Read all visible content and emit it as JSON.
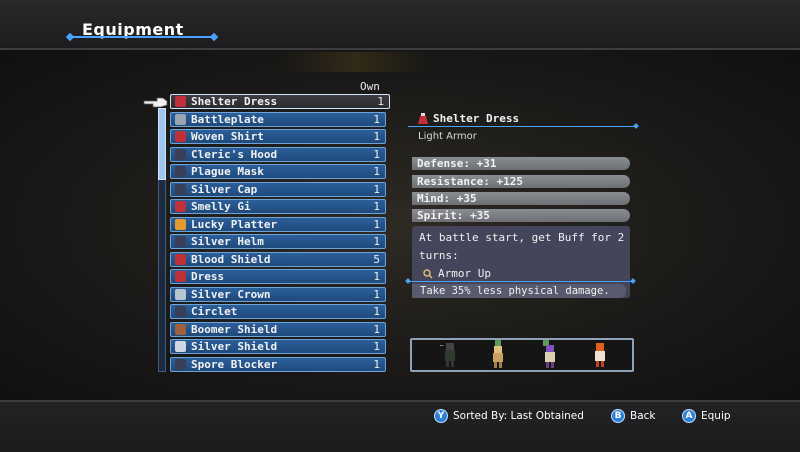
{
  "header": {
    "title": "Equipment"
  },
  "list": {
    "own_header": "Own",
    "items": [
      {
        "name": "Shelter Dress",
        "count": "1",
        "icon": "dress-icon",
        "color": "#c0303a"
      },
      {
        "name": "Battleplate",
        "count": "1",
        "icon": "armor-icon",
        "color": "#9aa4b0"
      },
      {
        "name": "Woven Shirt",
        "count": "1",
        "icon": "shirt-icon",
        "color": "#c0303a"
      },
      {
        "name": "Cleric's Hood",
        "count": "1",
        "icon": "hood-icon",
        "color": "#3a3f58"
      },
      {
        "name": "Plague Mask",
        "count": "1",
        "icon": "mask-icon",
        "color": "#3a3f58"
      },
      {
        "name": "Silver Cap",
        "count": "1",
        "icon": "cap-icon",
        "color": "#3a3f58"
      },
      {
        "name": "Smelly Gi",
        "count": "1",
        "icon": "gi-icon",
        "color": "#c0303a"
      },
      {
        "name": "Lucky Platter",
        "count": "1",
        "icon": "platter-icon",
        "color": "#e09a30"
      },
      {
        "name": "Silver Helm",
        "count": "1",
        "icon": "helm-icon",
        "color": "#3a3f58"
      },
      {
        "name": "Blood Shield",
        "count": "5",
        "icon": "shield-icon",
        "color": "#c0303a"
      },
      {
        "name": "Dress",
        "count": "1",
        "icon": "dress-icon",
        "color": "#c0303a"
      },
      {
        "name": "Silver Crown",
        "count": "1",
        "icon": "crown-icon",
        "color": "#b8c4d0"
      },
      {
        "name": "Circlet",
        "count": "1",
        "icon": "circlet-icon",
        "color": "#3a3f58"
      },
      {
        "name": "Boomer Shield",
        "count": "1",
        "icon": "shield-icon",
        "color": "#a06040"
      },
      {
        "name": "Silver Shield",
        "count": "1",
        "icon": "shield-icon",
        "color": "#d0d8e0"
      },
      {
        "name": "Spore Blocker",
        "count": "1",
        "icon": "mushroom-icon",
        "color": "#3a3f58"
      }
    ]
  },
  "detail": {
    "name": "Shelter Dress",
    "type": "Light Armor",
    "stats": [
      "Defense:  +31",
      "Resistance:  +125",
      "Mind:  +35",
      "Spirit:  +35"
    ],
    "effect": "At battle start, get Buff for 2 turns:",
    "buff_name": "Armor Up",
    "buff_desc": "Take 35% less physical damage."
  },
  "footer": {
    "sort_key": "Y",
    "sort_label": "Sorted By: Last Obtained",
    "back_key": "B",
    "back_label": "Back",
    "equip_key": "A",
    "equip_label": "Equip"
  },
  "colors": {
    "accent": "#4aa3ff",
    "row": "#1f4a7c",
    "row_border": "#6fa3d6"
  }
}
